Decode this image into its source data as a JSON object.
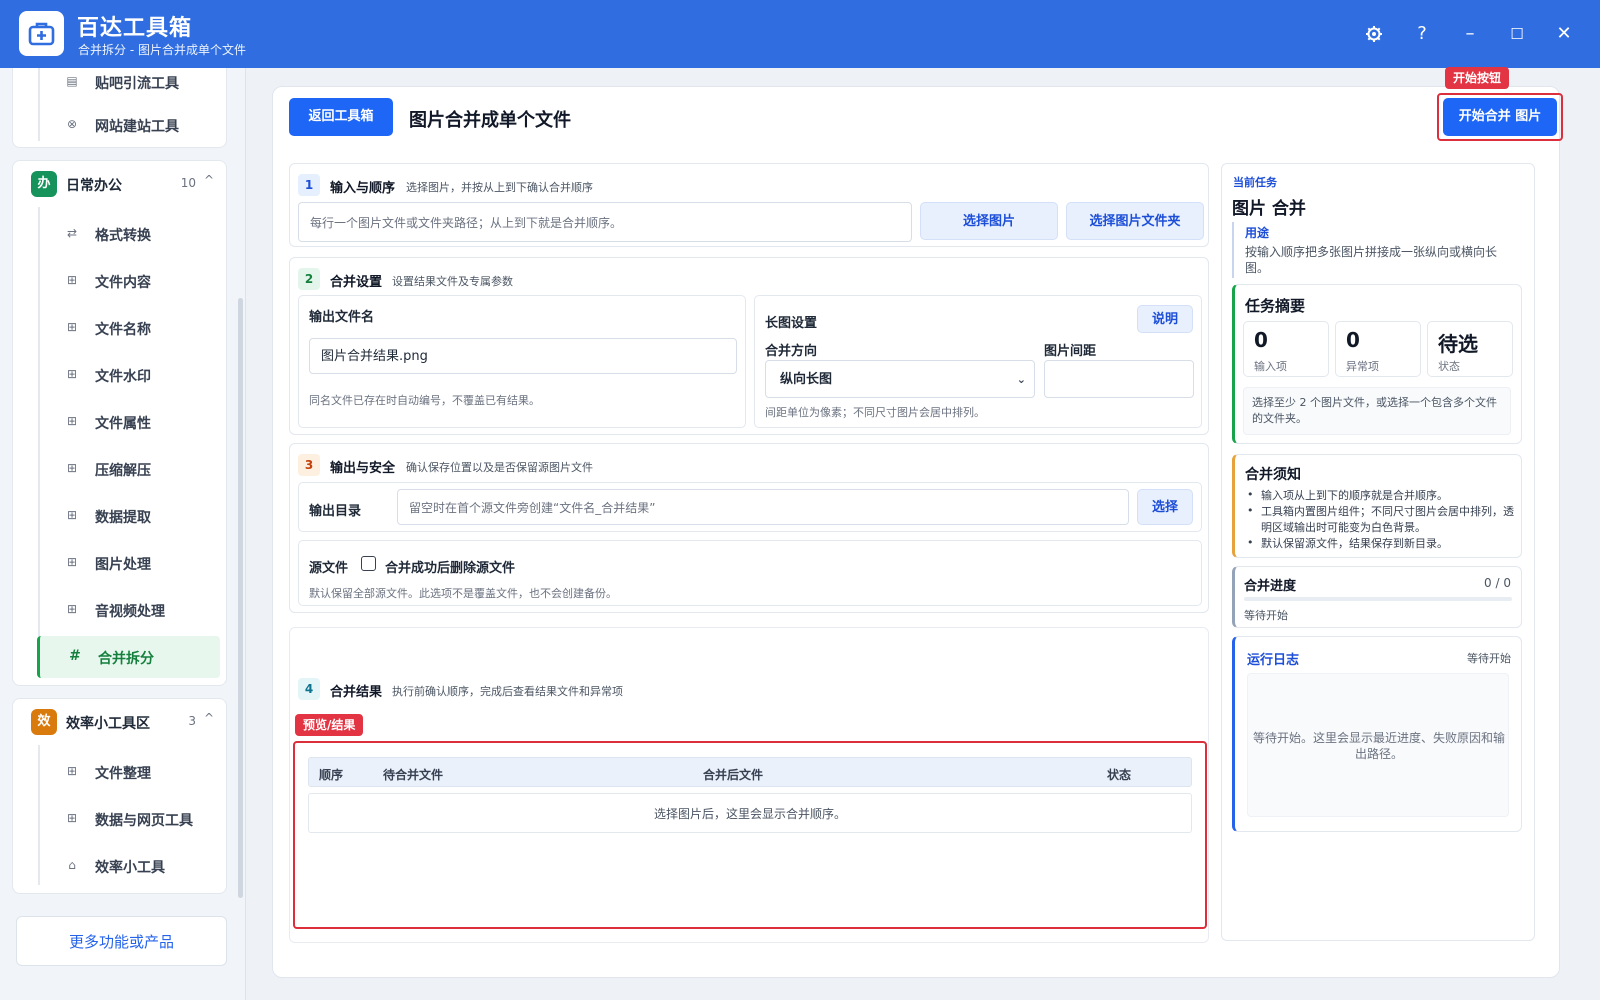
{
  "app": {
    "title": "百达工具箱",
    "subtitle": "合并拆分 - 图片合并成单个文件",
    "window_icons": [
      "gear-icon",
      "help-icon",
      "minimize-icon",
      "maximize-icon",
      "close-icon"
    ],
    "window_glyphs": {
      "help": "?",
      "minimize": "–",
      "maximize": "☐",
      "close": "✕"
    }
  },
  "sidebar": {
    "top_items": [
      {
        "label": "贴吧引流工具",
        "glyph": "▤"
      },
      {
        "label": "网站建站工具",
        "glyph": "⊗"
      }
    ],
    "groups": [
      {
        "badge": "办",
        "badge_color": "#15935b",
        "title": "日常办公",
        "count": "10",
        "caret": "^",
        "items": [
          {
            "label": "格式转换",
            "glyph": "⇄"
          },
          {
            "label": "文件内容",
            "glyph": "⊞"
          },
          {
            "label": "文件名称",
            "glyph": "⊞"
          },
          {
            "label": "文件水印",
            "glyph": "⊞"
          },
          {
            "label": "文件属性",
            "glyph": "⊞"
          },
          {
            "label": "压缩解压",
            "glyph": "⊞"
          },
          {
            "label": "数据提取",
            "glyph": "⊞"
          },
          {
            "label": "图片处理",
            "glyph": "⊞"
          },
          {
            "label": "音视频处理",
            "glyph": "⊞"
          },
          {
            "label": "合并拆分",
            "glyph": "#",
            "active": true
          }
        ]
      },
      {
        "badge": "效",
        "badge_color": "#d97a0c",
        "title": "效率小工具区",
        "count": "3",
        "caret": "^",
        "items": [
          {
            "label": "文件整理",
            "glyph": "⊞"
          },
          {
            "label": "数据与网页工具",
            "glyph": "⊞"
          },
          {
            "label": "效率小工具",
            "glyph": "⌂"
          }
        ]
      }
    ],
    "more_button": "更多功能或产品"
  },
  "header": {
    "back_button": "返回工具箱",
    "page_title": "图片合并成单个文件",
    "start_tag": "开始按钮",
    "start_button": "开始合并 图片"
  },
  "step1": {
    "num": "1",
    "title": "输入与顺序",
    "desc": "选择图片，并按从上到下确认合并顺序",
    "input_placeholder": "每行一个图片文件或文件夹路径；从上到下就是合并顺序。",
    "btn_select_images": "选择图片",
    "btn_select_folder": "选择图片文件夹"
  },
  "step2": {
    "num": "2",
    "title": "合并设置",
    "desc": "设置结果文件及专属参数",
    "output_name_label": "输出文件名",
    "output_name_value": "图片合并结果.png",
    "output_name_hint": "同名文件已存在时自动编号，不覆盖已有结果。",
    "long_image_label": "长图设置",
    "explain_button": "说明",
    "direction_label": "合并方向",
    "direction_value": "纵向长图",
    "spacing_label": "图片间距",
    "spacing_value": "",
    "spacing_hint": "间距单位为像素；不同尺寸图片会居中排列。"
  },
  "step3": {
    "num": "3",
    "title": "输出与安全",
    "desc": "确认保存位置以及是否保留源图片文件",
    "output_dir_label": "输出目录",
    "output_dir_placeholder": "留空时在首个源文件旁创建“文件名_合并结果”",
    "choose_button": "选择",
    "source_label": "源文件",
    "delete_checkbox_label": "合并成功后删除源文件",
    "source_hint": "默认保留全部源文件。此选项不是覆盖文件，也不会创建备份。"
  },
  "step4": {
    "num": "4",
    "title": "合并结果",
    "desc": "执行前确认顺序，完成后查看结果文件和异常项",
    "preview_tag": "预览/结果",
    "columns": [
      "顺序",
      "待合并文件",
      "合并后文件",
      "状态"
    ],
    "empty_text": "选择图片后，这里会显示合并顺序。"
  },
  "right_panel": {
    "current_task_label": "当前任务",
    "task_name": "图片 合并",
    "purpose_label": "用途",
    "purpose_text": "按输入顺序把多张图片拼接成一张纵向或横向长图。",
    "summary_title": "任务摘要",
    "stats": [
      {
        "value": "0",
        "caption": "输入项"
      },
      {
        "value": "0",
        "caption": "异常项"
      },
      {
        "value": "待选",
        "caption": "状态"
      }
    ],
    "summary_hint": "选择至少 2 个图片文件，或选择一个包含多个文件的文件夹。",
    "notes_title": "合并须知",
    "notes": [
      "输入项从上到下的顺序就是合并顺序。",
      "工具箱内置图片组件；不同尺寸图片会居中排列，透明区域输出时可能变为白色背景。",
      "默认保留源文件，结果保存到新目录。"
    ],
    "progress_title": "合并进度",
    "progress_value": "0 / 0",
    "progress_fraction": 0,
    "progress_status": "等待开始",
    "log_title": "运行日志",
    "log_status": "等待开始",
    "log_placeholder": "等待开始。这里会显示最近进度、失败原因和输出路径。"
  },
  "colors": {
    "brand": "#2f6de0",
    "primary_button": "#1e66f5",
    "highlight_red": "#dc2f3b",
    "active_green": "#16a34a"
  }
}
